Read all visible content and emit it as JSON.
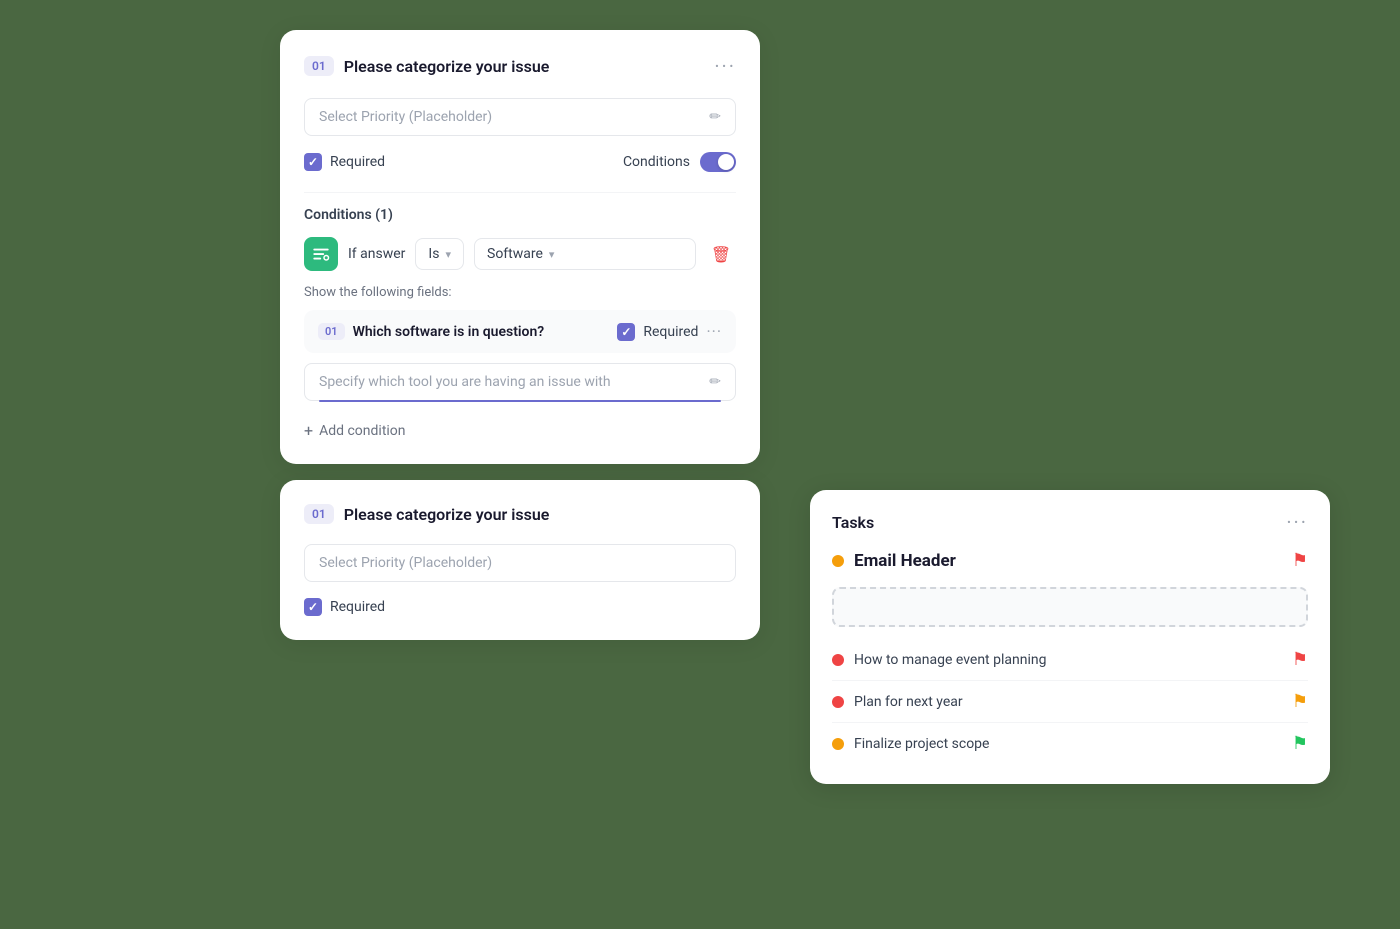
{
  "topCard": {
    "stepBadge": "01",
    "title": "Please categorize your issue",
    "moreLabel": "···",
    "inputPlaceholder": "Select Priority (Placeholder)",
    "requiredLabel": "Required",
    "conditionsLabel": "Conditions",
    "conditionsCount": "Conditions (1)",
    "ifAnswerLabel": "If answer",
    "isLabel": "Is",
    "softwareLabel": "Software",
    "showFieldsLabel": "Show the following fields:",
    "subQuestion": {
      "step": "01",
      "title": "Which software is in question?",
      "requiredLabel": "Required"
    },
    "subInputPlaceholder": "Specify which tool you are having an issue with",
    "addConditionLabel": "Add condition"
  },
  "bottomCard": {
    "stepBadge": "01",
    "title": "Please categorize your issue",
    "inputPlaceholder": "Select Priority (Placeholder)",
    "requiredLabel": "Required"
  },
  "tasksPanel": {
    "title": "Tasks",
    "moreLabel": "···",
    "emailHeader": {
      "title": "Email Header",
      "flagColor": "red"
    },
    "tasks": [
      {
        "text": "How to manage event planning",
        "dotColor": "red",
        "flagColor": "red"
      },
      {
        "text": "Plan for next year",
        "dotColor": "red",
        "flagColor": "yellow"
      },
      {
        "text": "Finalize project scope",
        "dotColor": "yellow",
        "flagColor": "green"
      }
    ]
  },
  "icons": {
    "edit": "✏",
    "delete": "🗑",
    "checkmark": "✓",
    "plus": "+",
    "chevronDown": "▾",
    "moreOptions": "···",
    "flagRed": "⚑",
    "flagYellow": "⚑",
    "flagGreen": "⚑"
  }
}
